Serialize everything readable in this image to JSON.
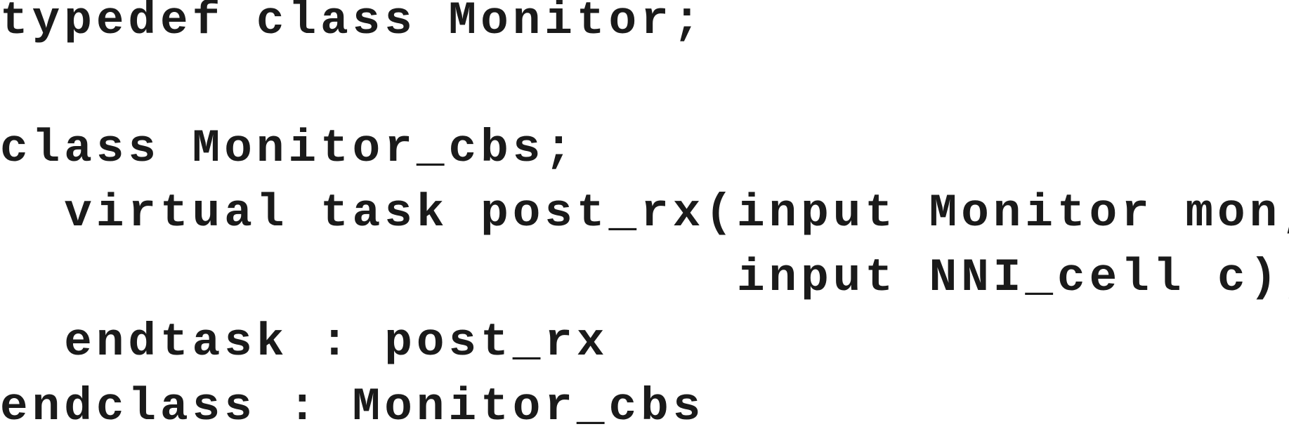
{
  "code": {
    "lines": [
      "typedef class Monitor;",
      "",
      "class Monitor_cbs;",
      "  virtual task post_rx(input Monitor mon,",
      "                       input NNI_cell c);",
      "  endtask : post_rx",
      "endclass : Monitor_cbs"
    ]
  }
}
